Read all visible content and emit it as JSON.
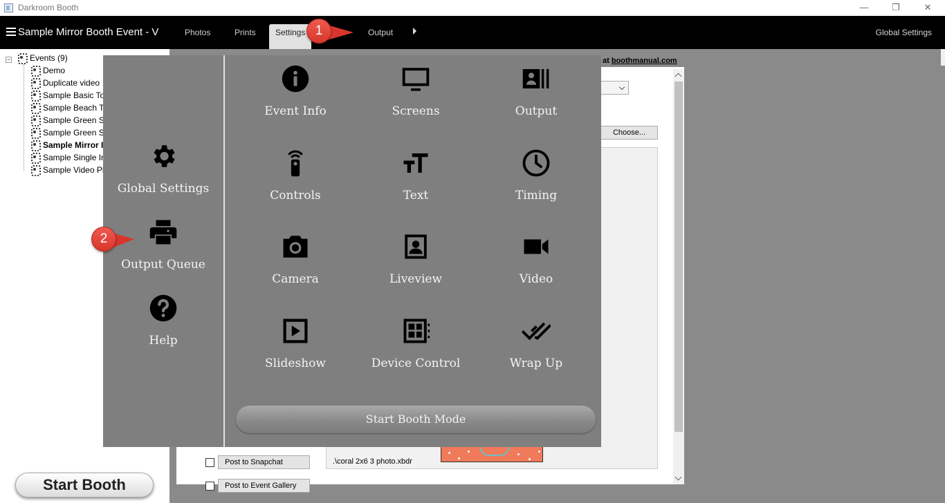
{
  "window": {
    "title": "Darkroom Booth"
  },
  "menubar": {
    "event_title": "Sample Mirror Booth Event - V",
    "tabs": [
      {
        "label": "Photos"
      },
      {
        "label": "Prints"
      },
      {
        "label": "Settings",
        "active": true
      },
      {
        "label": "Output"
      }
    ],
    "global_settings": "Global Settings"
  },
  "tree": {
    "root": "Events (9)",
    "items": [
      {
        "label": "Demo"
      },
      {
        "label": "Duplicate video"
      },
      {
        "label": "Sample Basic To"
      },
      {
        "label": "Sample Beach Th"
      },
      {
        "label": "Sample Green Sc"
      },
      {
        "label": "Sample Green Sc"
      },
      {
        "label": "Sample Mirror I",
        "selected": true
      },
      {
        "label": "Sample Single In"
      },
      {
        "label": "Sample Video Ph"
      }
    ]
  },
  "start_booth": "Start Booth",
  "background": {
    "manual_prefix": "at ",
    "manual_link": "boothmanual.com",
    "choose_button": "Choose...",
    "file_path": ".\\coral 2x6 3 photo.xbdr",
    "options": [
      {
        "label": "Post to Snapchat",
        "checked": false
      },
      {
        "label": "Post to Event Gallery",
        "checked": false
      }
    ]
  },
  "overlay": {
    "left_items": [
      {
        "label": "Global Settings",
        "icon": "gear-icon"
      },
      {
        "label": "Output Queue",
        "icon": "printer-icon"
      },
      {
        "label": "Help",
        "icon": "help-icon"
      }
    ],
    "grid": [
      {
        "label": "Event Info",
        "icon": "info-icon"
      },
      {
        "label": "Screens",
        "icon": "monitor-icon"
      },
      {
        "label": "Output",
        "icon": "output-icon"
      },
      {
        "label": "Controls",
        "icon": "remote-icon"
      },
      {
        "label": "Text",
        "icon": "text-size-icon"
      },
      {
        "label": "Timing",
        "icon": "clock-icon"
      },
      {
        "label": "Camera",
        "icon": "camera-icon"
      },
      {
        "label": "Liveview",
        "icon": "portrait-icon"
      },
      {
        "label": "Video",
        "icon": "video-icon"
      },
      {
        "label": "Slideshow",
        "icon": "play-icon"
      },
      {
        "label": "Device Control",
        "icon": "device-grid-icon"
      },
      {
        "label": "Wrap Up",
        "icon": "double-check-icon"
      }
    ],
    "start_booth_mode": "Start Booth Mode"
  },
  "callouts": [
    {
      "number": "1",
      "color": "#e0443a"
    },
    {
      "number": "2",
      "color": "#e0443a"
    }
  ]
}
